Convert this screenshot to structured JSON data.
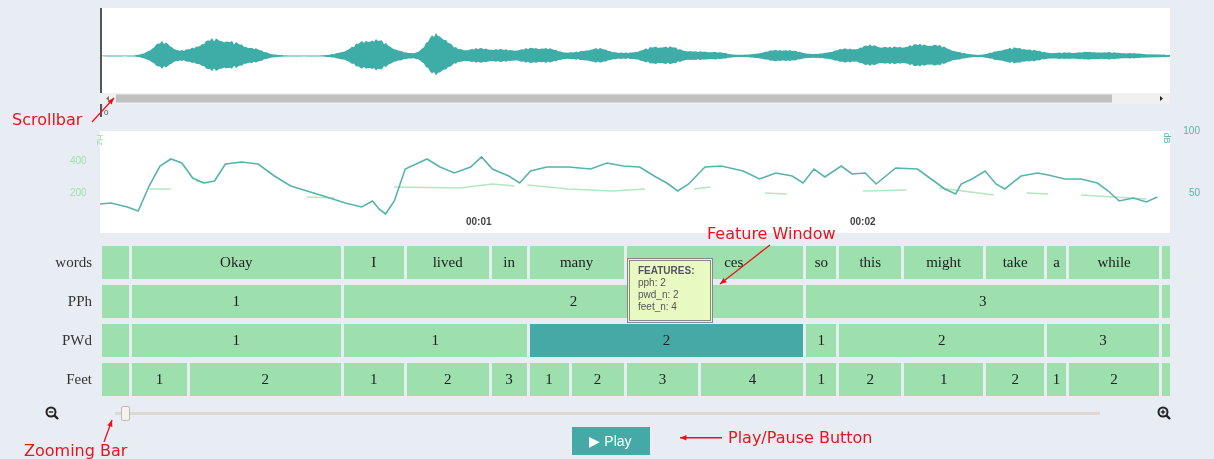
{
  "timeline": {
    "labels": [
      "0"
    ]
  },
  "pitch_chart": {
    "left_unit": "Hz",
    "left_ticks": [
      "400",
      "200"
    ],
    "right_unit": "dB",
    "right_ticks": [
      "100",
      "50"
    ],
    "time_labels": [
      "00:01",
      "00:02"
    ]
  },
  "tiers": [
    {
      "label": "words",
      "cells": [
        {
          "kind": "blank",
          "selected": false
        },
        {
          "kind": "segment",
          "text": "Okay",
          "selected": false
        },
        {
          "kind": "segment",
          "text": "I",
          "selected": false
        },
        {
          "kind": "segment",
          "text": "lived",
          "selected": false
        },
        {
          "kind": "segment",
          "text": "in",
          "selected": false
        },
        {
          "kind": "segment",
          "text": "many",
          "selected": false
        },
        {
          "kind": "segment",
          "text": "ces",
          "selected": false
        },
        {
          "kind": "segment",
          "text": "so",
          "selected": false
        },
        {
          "kind": "segment",
          "text": "this",
          "selected": false
        },
        {
          "kind": "segment",
          "text": "might",
          "selected": false
        },
        {
          "kind": "segment",
          "text": "take",
          "selected": false
        },
        {
          "kind": "segment",
          "text": "a",
          "selected": false
        },
        {
          "kind": "segment",
          "text": "while",
          "selected": false
        },
        {
          "kind": "blank",
          "selected": false
        }
      ]
    },
    {
      "label": "PPh",
      "cells": [
        {
          "kind": "blank",
          "selected": false
        },
        {
          "kind": "segment",
          "text": "1",
          "selected": false
        },
        {
          "kind": "segment",
          "text": "2",
          "selected": false
        },
        {
          "kind": "segment",
          "text": "3",
          "selected": false
        },
        {
          "kind": "blank",
          "selected": false
        }
      ]
    },
    {
      "label": "PWd",
      "cells": [
        {
          "kind": "blank",
          "selected": false
        },
        {
          "kind": "segment",
          "text": "1",
          "selected": false
        },
        {
          "kind": "segment",
          "text": "1",
          "selected": false
        },
        {
          "kind": "segment",
          "text": "2",
          "selected": true
        },
        {
          "kind": "segment",
          "text": "1",
          "selected": false
        },
        {
          "kind": "segment",
          "text": "2",
          "selected": false
        },
        {
          "kind": "segment",
          "text": "3",
          "selected": false
        },
        {
          "kind": "blank",
          "selected": false
        }
      ]
    },
    {
      "label": "Feet",
      "cells": [
        {
          "kind": "blank",
          "selected": false
        },
        {
          "kind": "segment",
          "text": "1",
          "selected": false
        },
        {
          "kind": "segment",
          "text": "2",
          "selected": false
        },
        {
          "kind": "segment",
          "text": "1",
          "selected": false
        },
        {
          "kind": "segment",
          "text": "2",
          "selected": false
        },
        {
          "kind": "segment",
          "text": "3",
          "selected": false
        },
        {
          "kind": "segment",
          "text": "1",
          "selected": false
        },
        {
          "kind": "segment",
          "text": "2",
          "selected": false
        },
        {
          "kind": "segment",
          "text": "3",
          "selected": false
        },
        {
          "kind": "segment",
          "text": "4",
          "selected": false
        },
        {
          "kind": "segment",
          "text": "1",
          "selected": false
        },
        {
          "kind": "segment",
          "text": "2",
          "selected": false
        },
        {
          "kind": "segment",
          "text": "1",
          "selected": false
        },
        {
          "kind": "segment",
          "text": "2",
          "selected": false
        },
        {
          "kind": "segment",
          "text": "1",
          "selected": false
        },
        {
          "kind": "segment",
          "text": "2",
          "selected": false
        },
        {
          "kind": "blank",
          "selected": false
        }
      ]
    }
  ],
  "feature_window": {
    "title": "FEATURES:",
    "lines": [
      "pph: 2",
      "pwd_n: 2",
      "feet_n: 4"
    ]
  },
  "zoom": {
    "level": 0.01
  },
  "play_button": {
    "label": "▶ Play"
  },
  "annotations": [
    {
      "text": "Scrollbar"
    },
    {
      "text": "Feature Window"
    },
    {
      "text": "Zooming Bar"
    },
    {
      "text": "Play/Pause Button"
    }
  ]
}
